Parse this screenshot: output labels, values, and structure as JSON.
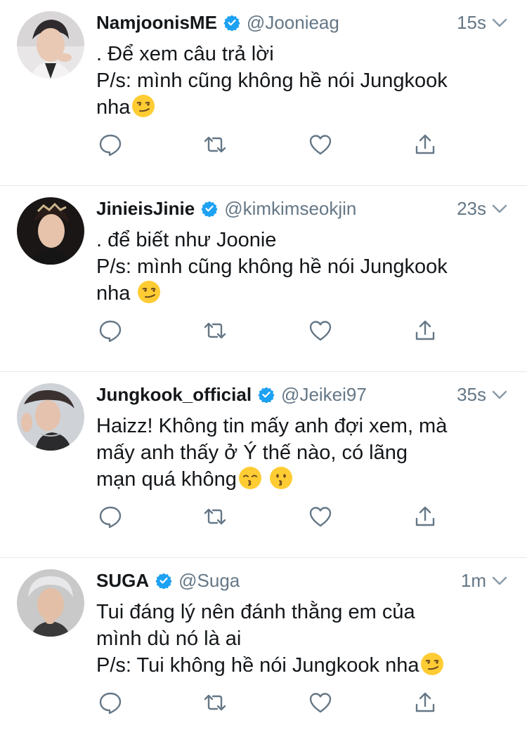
{
  "colors": {
    "text": "#14171a",
    "secondary": "#657786",
    "verified_blue": "#1da1f2",
    "divider": "#e1e8ed",
    "icon_gray": "#657786"
  },
  "tweets": [
    {
      "display_name": "NamjoonisME",
      "handle": "@Joonieag",
      "time": "15s",
      "verified": true,
      "avatar_icon": "avatar-namjoon",
      "lines": [
        ". Để xem câu trả lời",
        "P/s: mình cũng không hề nói Jungkook",
        "nha"
      ],
      "emojis": [
        "smirk-emoji"
      ]
    },
    {
      "display_name": "JinieisJinie",
      "handle": "@kimkimseokjin",
      "time": "23s",
      "verified": true,
      "avatar_icon": "avatar-jin",
      "lines": [
        ". để biết như Joonie",
        "P/s: mình cũng không hề nói Jungkook",
        "nha "
      ],
      "emojis": [
        "smirk-emoji"
      ]
    },
    {
      "display_name": "Jungkook_official",
      "handle": "@Jeikei97",
      "time": "35s",
      "verified": true,
      "avatar_icon": "avatar-jungkook",
      "lines": [
        "Haizz! Không tin mấy anh đợi xem, mà",
        "mấy anh thấy ở Ý thế nào, có lãng",
        "mạn quá không"
      ],
      "emojis": [
        "kissing-smiling-eyes-emoji",
        "kissing-emoji"
      ]
    },
    {
      "display_name": "SUGA",
      "handle": "@Suga",
      "time": "1m",
      "verified": true,
      "avatar_icon": "avatar-suga",
      "lines": [
        "Tui đáng lý nên đánh thằng em của",
        "mình dù nó là ai",
        "P/s: Tui không hề nói Jungkook nha"
      ],
      "emojis": [
        "smirk-emoji"
      ]
    }
  ],
  "action_icons": [
    "reply-icon",
    "retweet-icon",
    "like-icon",
    "share-icon"
  ]
}
